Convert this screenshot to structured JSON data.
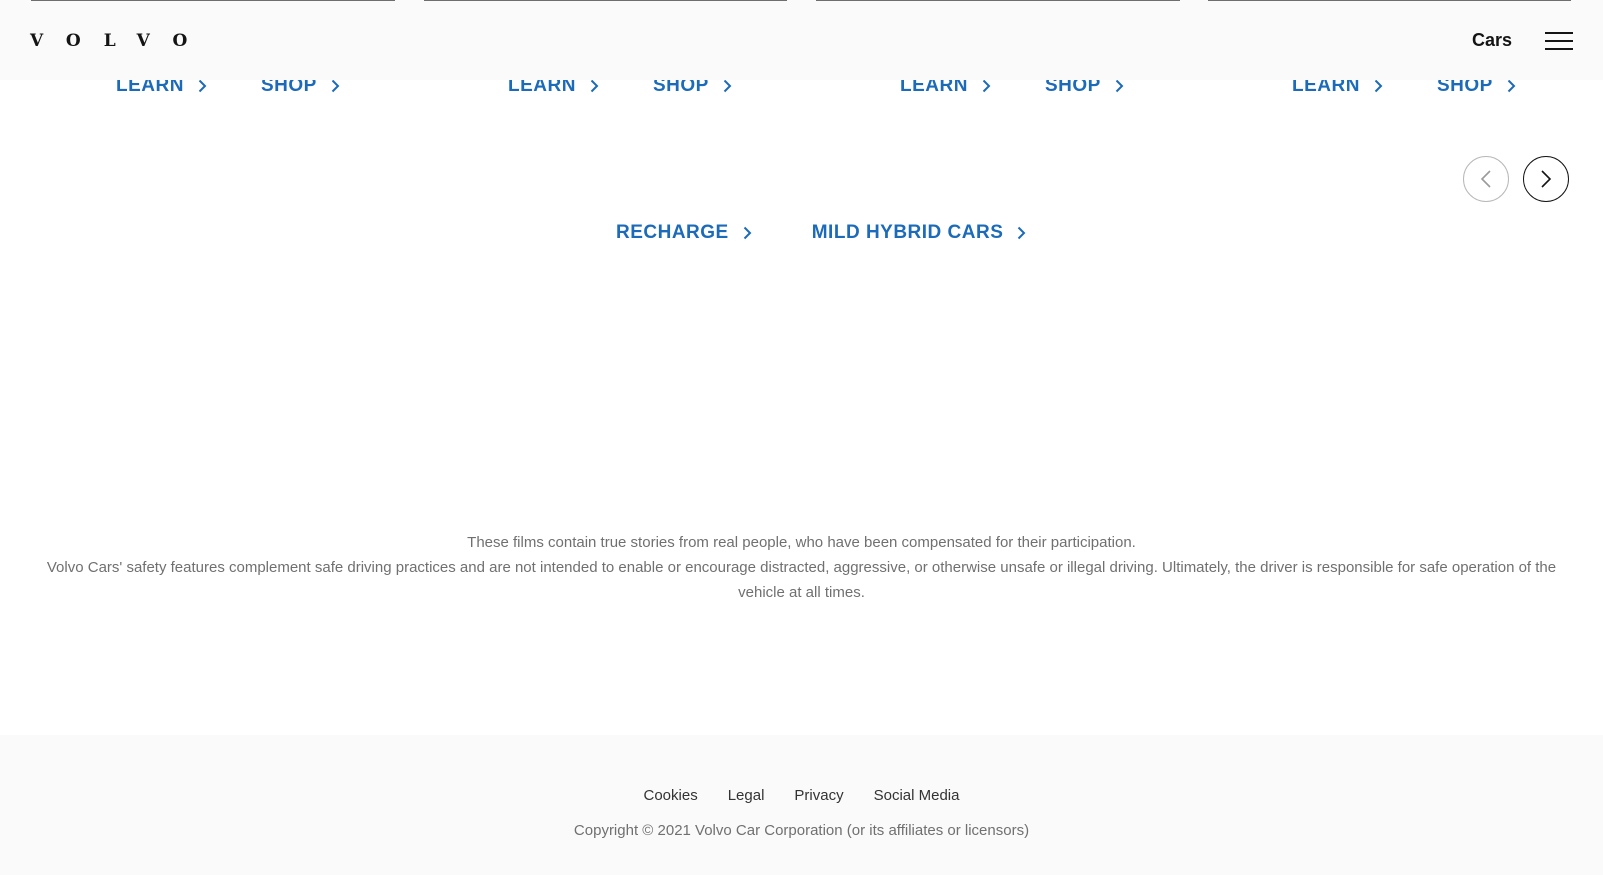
{
  "header": {
    "logo_text": "VOLVO",
    "nav_label": "Cars",
    "menu_icon": "hamburger-menu-icon"
  },
  "cards": [
    {
      "learn_label": "LEARN",
      "shop_label": "SHOP"
    },
    {
      "learn_label": "LEARN",
      "shop_label": "SHOP"
    },
    {
      "learn_label": "LEARN",
      "shop_label": "SHOP"
    },
    {
      "learn_label": "LEARN",
      "shop_label": "SHOP"
    }
  ],
  "carousel": {
    "prev_icon": "chevron-left-icon",
    "next_icon": "chevron-right-icon"
  },
  "categories": {
    "recharge_label": "RECHARGE",
    "mild_hybrid_label": "MILD HYBRID CARS"
  },
  "disclaimer": {
    "line1": "These films contain true stories from real people, who have been compensated for their participation.",
    "line2": "Volvo Cars' safety features complement safe driving practices and are not intended to enable or encourage distracted, aggressive, or otherwise unsafe or illegal driving. Ultimately, the driver is responsible for safe operation of the vehicle at all times."
  },
  "footer": {
    "links": [
      "Cookies",
      "Legal",
      "Privacy",
      "Social Media"
    ],
    "copyright": "Copyright © 2021 Volvo Car Corporation (or its affiliates or licensors)"
  },
  "colors": {
    "link_blue": "#1c6bba",
    "footer_bg": "#fafafa",
    "text_gray": "#707070"
  }
}
